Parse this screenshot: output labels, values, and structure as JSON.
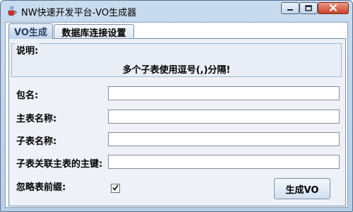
{
  "window": {
    "title": "NW快速开发平台-VO生成器",
    "icon": "java-coffee-icon"
  },
  "tabs": [
    {
      "label": "VO生成",
      "active": true
    },
    {
      "label": "数据库连接设置",
      "active": false
    }
  ],
  "info": {
    "legend": "说明:",
    "text": "多个子表使用逗号(,)分隔!"
  },
  "form": {
    "package_label": "包名:",
    "package_value": "",
    "main_table_label": "主表名称:",
    "main_table_value": "",
    "sub_table_label": "子表名称:",
    "sub_table_value": "",
    "sub_fk_label": "子表关联主表的主键:",
    "sub_fk_value": "",
    "ignore_prefix_label": "忽略表前缀:",
    "ignore_prefix_checked": true
  },
  "actions": {
    "generate_label": "生成VO"
  },
  "colors": {
    "title_bar": "#c9dbee",
    "close_button": "#c9412b",
    "active_tab": "#bcd3ee"
  }
}
